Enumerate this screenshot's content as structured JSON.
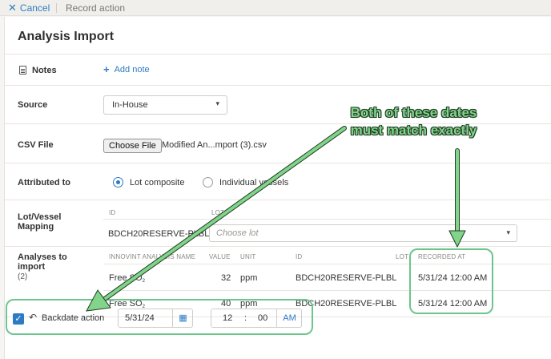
{
  "topbar": {
    "cancel_label": "Cancel",
    "record_action_label": "Record action"
  },
  "page": {
    "title": "Analysis Import"
  },
  "notes": {
    "label": "Notes",
    "add_note_label": "Add note"
  },
  "source": {
    "label": "Source",
    "selected": "In-House"
  },
  "csv": {
    "label": "CSV File",
    "button_label": "Choose File",
    "file_name": "Modified An...mport (3).csv"
  },
  "attributed": {
    "label": "Attributed to",
    "options": [
      {
        "label": "Lot composite",
        "selected": true
      },
      {
        "label": "Individual vessels",
        "selected": false
      }
    ]
  },
  "mapping": {
    "label_line1": "Lot/Vessel",
    "label_line2": "Mapping",
    "col_id": "ID",
    "col_lot": "LOT",
    "id_value": "BDCH20RESERVE-PLBL",
    "lot_placeholder": "Choose lot"
  },
  "analyses": {
    "label_line1": "Analyses to",
    "label_line2": "import",
    "count": "(2)",
    "columns": [
      "INNOVINT ANALYSIS NAME",
      "VALUE",
      "UNIT",
      "ID",
      "LOT",
      "RECORDED AT"
    ],
    "rows": [
      {
        "name": "Free SO",
        "sub": "2",
        "value": "32",
        "unit": "ppm",
        "id": "BDCH20RESERVE-PLBL",
        "lot": "",
        "recorded_at": "5/31/24 12:00 AM"
      },
      {
        "name": "Free SO",
        "sub": "2",
        "value": "40",
        "unit": "ppm",
        "id": "BDCH20RESERVE-PLBL",
        "lot": "",
        "recorded_at": "5/31/24 12:00 AM"
      }
    ]
  },
  "backdate": {
    "checked": true,
    "label": "Backdate action",
    "date": "5/31/24",
    "hour": "12",
    "minute": "00",
    "ampm": "AM"
  },
  "annotation": {
    "line1": "Both of these dates",
    "line2": "must match exactly"
  },
  "colors": {
    "accent": "#2d7bc4",
    "highlight_green": "#6dc58c",
    "annotation_green": "#82d48a"
  },
  "icons": {
    "cancel": "close-icon",
    "notes": "document-icon",
    "add_note": "plus-icon",
    "source": "chevron-down-icon",
    "lot": "chevron-down-icon",
    "backdate_toggle": "checkmark-icon",
    "backdate_action": "undo-arrow-icon",
    "date_picker": "calendar-icon"
  }
}
